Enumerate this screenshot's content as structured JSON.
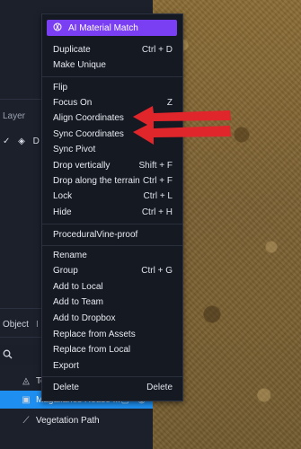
{
  "left": {
    "layer_label": "Layer",
    "layer_item": "D",
    "tabs": [
      "Object",
      "I"
    ],
    "tree": [
      {
        "label": "Te"
      },
      {
        "label": "Magallanes House ..."
      },
      {
        "label": "Vegetation Path"
      }
    ]
  },
  "menu": {
    "header": "AI Material Match",
    "items": [
      {
        "label": "Duplicate",
        "shortcut": "Ctrl + D"
      },
      {
        "label": "Make Unique",
        "shortcut": ""
      },
      {
        "label": "Flip",
        "shortcut": ""
      },
      {
        "label": "Focus On",
        "shortcut": "Z"
      },
      {
        "label": "Align Coordinates",
        "shortcut": ""
      },
      {
        "label": "Sync Coordinates",
        "shortcut": ""
      },
      {
        "label": "Sync Pivot",
        "shortcut": ""
      },
      {
        "label": "Drop vertically",
        "shortcut": "Shift + F"
      },
      {
        "label": "Drop along the terrain",
        "shortcut": "Ctrl + F"
      },
      {
        "label": "Lock",
        "shortcut": "Ctrl + L"
      },
      {
        "label": "Hide",
        "shortcut": "Ctrl + H"
      },
      {
        "label": "ProceduralVine-proof",
        "shortcut": ""
      },
      {
        "label": "Rename",
        "shortcut": ""
      },
      {
        "label": "Group",
        "shortcut": "Ctrl + G"
      },
      {
        "label": "Add to Local",
        "shortcut": ""
      },
      {
        "label": "Add to Team",
        "shortcut": ""
      },
      {
        "label": "Add to Dropbox",
        "shortcut": ""
      },
      {
        "label": "Replace from Assets",
        "shortcut": ""
      },
      {
        "label": "Replace from Local",
        "shortcut": ""
      },
      {
        "label": "Export",
        "shortcut": ""
      },
      {
        "label": "Delete",
        "shortcut": "Delete"
      }
    ]
  },
  "colors": {
    "accent": "#7a3ff2",
    "selection": "#1e8ff0",
    "arrow": "#e0262b"
  },
  "icons": {
    "header": "globe-icon",
    "search": "search-icon",
    "check": "check-icon",
    "layers": "layers-icon",
    "terrain": "terrain-icon",
    "cube": "cube-icon",
    "path": "path-icon",
    "eye": "eye-icon"
  }
}
